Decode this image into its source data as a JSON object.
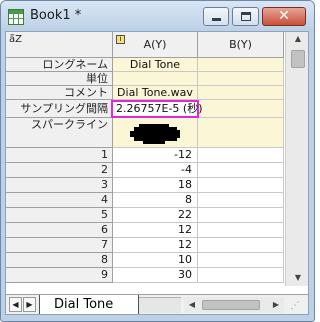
{
  "window": {
    "title": "Book1 *",
    "close_glyph": "✕"
  },
  "grid": {
    "corner_glyph": "ā̄Z",
    "columns": [
      {
        "label": "A(Y)",
        "has_icon": true,
        "icon_glyph": "i"
      },
      {
        "label": "B(Y)"
      }
    ],
    "meta_rows": {
      "long_name": {
        "label": "ロングネーム",
        "a": "Dial Tone",
        "b": ""
      },
      "units": {
        "label": "単位",
        "a": "",
        "b": ""
      },
      "comments": {
        "label": "コメント",
        "a": "Dial Tone.wav",
        "b": ""
      },
      "sampling_interval": {
        "label": "サンプリング間隔",
        "a": "2.26757E-5 (秒)",
        "b": ""
      },
      "sparkline": {
        "label": "スパークライン"
      }
    },
    "data_rows": [
      {
        "index": "1",
        "a": "-12",
        "b": ""
      },
      {
        "index": "2",
        "a": "-4",
        "b": ""
      },
      {
        "index": "3",
        "a": "18",
        "b": ""
      },
      {
        "index": "4",
        "a": "8",
        "b": ""
      },
      {
        "index": "5",
        "a": "22",
        "b": ""
      },
      {
        "index": "6",
        "a": "12",
        "b": ""
      },
      {
        "index": "7",
        "a": "12",
        "b": ""
      },
      {
        "index": "8",
        "a": "10",
        "b": ""
      },
      {
        "index": "9",
        "a": "30",
        "b": ""
      }
    ]
  },
  "sheet_tabs": {
    "active": "Dial Tone",
    "prev_glyph": "◀",
    "next_glyph": "▶"
  },
  "scrollbars": {
    "up_glyph": "▲",
    "down_glyph": "▼",
    "left_glyph": "◀",
    "right_glyph": "▶",
    "grip_glyph": "⋰"
  },
  "colors": {
    "highlight_border": "#e028d8",
    "meta_row_bg": "#fbf6d6",
    "sparkline": "#000000"
  }
}
